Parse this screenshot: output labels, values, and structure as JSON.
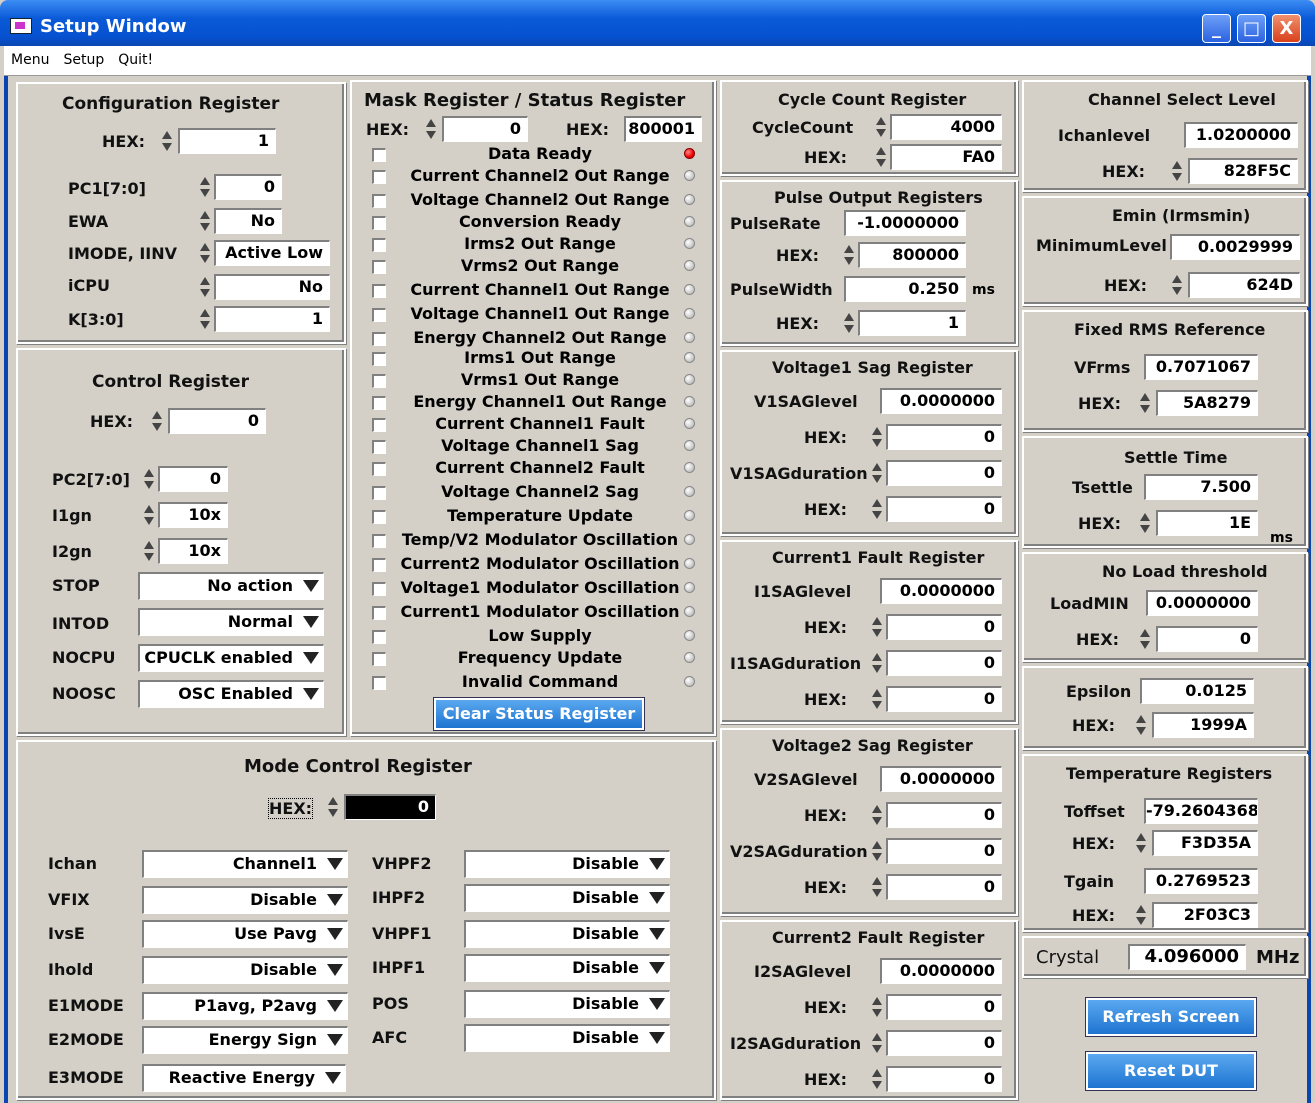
{
  "window": {
    "title": "Setup Window",
    "min": "_",
    "max": "□",
    "close": "X"
  },
  "menu": [
    "Menu",
    "Setup",
    "Quit!"
  ],
  "config": {
    "title": "Configuration Register",
    "hex_label": "HEX:",
    "hex": "1",
    "rows": [
      {
        "label": "PC1[7:0]",
        "value": "0"
      },
      {
        "label": "EWA",
        "value": "No"
      },
      {
        "label": "IMODE, IINV",
        "value": "Active Low"
      },
      {
        "label": "iCPU",
        "value": "No"
      },
      {
        "label": "K[3:0]",
        "value": "1"
      }
    ]
  },
  "control": {
    "title": "Control Register",
    "hex_label": "HEX:",
    "hex": "0",
    "spins": [
      {
        "label": "PC2[7:0]",
        "value": "0"
      },
      {
        "label": "I1gn",
        "value": "10x"
      },
      {
        "label": "I2gn",
        "value": "10x"
      }
    ],
    "drops": [
      {
        "label": "STOP",
        "value": "No action"
      },
      {
        "label": "INTOD",
        "value": "Normal"
      },
      {
        "label": "NOCPU",
        "value": "CPUCLK enabled"
      },
      {
        "label": "NOOSC",
        "value": "OSC Enabled"
      }
    ]
  },
  "mask": {
    "title": "Mask Register / Status Register",
    "hex_label": "HEX:",
    "mask_hex": "0",
    "status_hex_label": "HEX:",
    "status_hex": "800001",
    "items": [
      "Data Ready",
      "Current Channel2 Out Range",
      "Voltage Channel2 Out Range",
      "Conversion Ready",
      "Irms2 Out Range",
      "Vrms2 Out Range",
      "Current Channel1 Out Range",
      "Voltage Channel1 Out Range",
      "Energy Channel2 Out Range",
      "Irms1 Out Range",
      "Vrms1 Out Range",
      "Energy Channel1 Out Range",
      "Current Channel1 Fault",
      "Voltage Channel1 Sag",
      "Current Channel2 Fault",
      "Voltage Channel2 Sag",
      "Temperature Update",
      "Temp/V2 Modulator Oscillation",
      "Current2 Modulator Oscillation",
      "Voltage1 Modulator Oscillation",
      "Current1 Modulator Oscillation",
      "Low Supply",
      "Frequency Update",
      "Invalid Command"
    ],
    "clear_button": "Clear Status Register"
  },
  "mode": {
    "title": "Mode Control Register",
    "hex_label": "HEX:",
    "hex": "0",
    "left": [
      {
        "label": "Ichan",
        "value": "Channel1"
      },
      {
        "label": "VFIX",
        "value": "Disable"
      },
      {
        "label": "IvsE",
        "value": "Use Pavg"
      },
      {
        "label": "Ihold",
        "value": "Disable"
      },
      {
        "label": "E1MODE",
        "value": "P1avg, P2avg"
      },
      {
        "label": "E2MODE",
        "value": "Energy Sign"
      },
      {
        "label": "E3MODE",
        "value": "Reactive Energy"
      }
    ],
    "right": [
      {
        "label": "VHPF2",
        "value": "Disable"
      },
      {
        "label": "IHPF2",
        "value": "Disable"
      },
      {
        "label": "VHPF1",
        "value": "Disable"
      },
      {
        "label": "IHPF1",
        "value": "Disable"
      },
      {
        "label": "POS",
        "value": "Disable"
      },
      {
        "label": "AFC",
        "value": "Disable"
      }
    ]
  },
  "cycle": {
    "title": "Cycle Count Register",
    "l1": "CycleCount",
    "v1": "4000",
    "l2": "HEX:",
    "v2": "FA0"
  },
  "pulse": {
    "title": "Pulse Output Registers",
    "rate_label": "PulseRate",
    "rate": "-1.0000000",
    "hex_label": "HEX:",
    "rate_hex": "800000",
    "width_label": "PulseWidth",
    "width": "0.250",
    "width_unit": "ms",
    "width_hex": "1"
  },
  "v1sag": {
    "title": "Voltage1 Sag Register",
    "level_label": "V1SAGlevel",
    "level": "0.0000000",
    "hex_label": "HEX:",
    "level_hex": "0",
    "dur_label": "V1SAGduration",
    "dur": "0",
    "dur_hex": "0"
  },
  "i1fault": {
    "title": "Current1 Fault Register",
    "level_label": "I1SAGlevel",
    "level": "0.0000000",
    "hex_label": "HEX:",
    "level_hex": "0",
    "dur_label": "I1SAGduration",
    "dur": "0",
    "dur_hex": "0"
  },
  "v2sag": {
    "title": "Voltage2 Sag Register",
    "level_label": "V2SAGlevel",
    "level": "0.0000000",
    "hex_label": "HEX:",
    "level_hex": "0",
    "dur_label": "V2SAGduration",
    "dur": "0",
    "dur_hex": "0"
  },
  "i2fault": {
    "title": "Current2 Fault Register",
    "level_label": "I2SAGlevel",
    "level": "0.0000000",
    "hex_label": "HEX:",
    "level_hex": "0",
    "dur_label": "I2SAGduration",
    "dur": "0",
    "dur_hex": "0"
  },
  "chansel": {
    "title": "Channel Select Level",
    "label": "Ichanlevel",
    "value": "1.0200000",
    "hex_label": "HEX:",
    "hex": "828F5C"
  },
  "emin": {
    "title": "Emin (Irmsmin)",
    "label": "MinimumLevel",
    "value": "0.0029999",
    "hex_label": "HEX:",
    "hex": "624D"
  },
  "frms": {
    "title": "Fixed RMS Reference",
    "label": "VFrms",
    "value": "0.7071067",
    "hex_label": "HEX:",
    "hex": "5A8279"
  },
  "settle": {
    "title": "Settle Time",
    "label": "Tsettle",
    "value": "7.500",
    "hex_label": "HEX:",
    "hex": "1E",
    "unit": "ms"
  },
  "noload": {
    "title": "No Load threshold",
    "label": "LoadMIN",
    "value": "0.0000000",
    "hex_label": "HEX:",
    "hex": "0"
  },
  "epsilon": {
    "label": "Epsilon",
    "value": "0.0125",
    "hex_label": "HEX:",
    "hex": "1999A"
  },
  "temp": {
    "title": "Temperature Registers",
    "off_label": "Toffset",
    "off": "-79.2604368",
    "hex_label": "HEX:",
    "off_hex": "F3D35A",
    "gain_label": "Tgain",
    "gain": "0.2769523",
    "gain_hex": "2F03C3"
  },
  "crystal": {
    "label": "Crystal",
    "value": "4.096000",
    "unit": "MHz"
  },
  "buttons": {
    "refresh": "Refresh Screen",
    "reset": "Reset DUT"
  }
}
